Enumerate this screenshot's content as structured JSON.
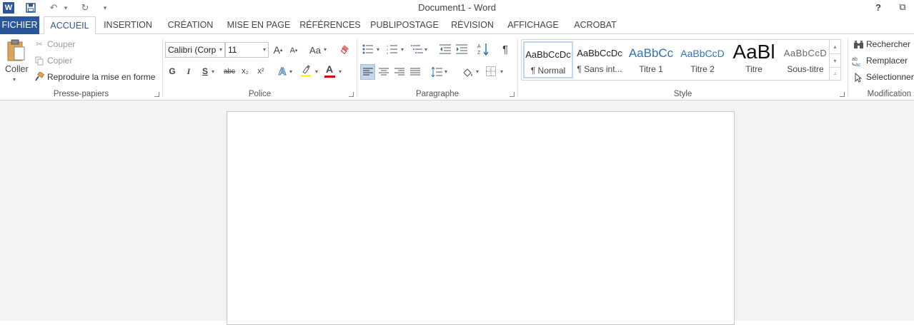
{
  "window": {
    "title": "Document1 - Word",
    "help": "?",
    "restore_glyph": "⧉",
    "minimize_glyph": "—",
    "close_glyph": "✕"
  },
  "qat": {
    "logo": "W",
    "save_glyph": "💾",
    "undo_glyph": "↶",
    "redo_glyph": "↻",
    "dd_glyph": "▾",
    "customize_glyph": "⩡"
  },
  "tabs": {
    "file": "FICHIER",
    "items": [
      "ACCUEIL",
      "INSERTION",
      "CRÉATION",
      "MISE EN PAGE",
      "RÉFÉRENCES",
      "PUBLIPOSTAGE",
      "RÉVISION",
      "AFFICHAGE",
      "ACROBAT"
    ]
  },
  "clipboard": {
    "label": "Presse-papiers",
    "paste": "Coller",
    "cut": "Couper",
    "copy": "Copier",
    "format_painter": "Reproduire la mise en forme"
  },
  "font": {
    "label": "Police",
    "font_name": "Calibri (Corp",
    "font_size": "11",
    "grow": "A",
    "shrink": "A",
    "change_case": "Aa",
    "bold": "G",
    "italic": "I",
    "underline": "S",
    "strike": "abc",
    "subscript": "x₂",
    "superscript": "x²",
    "text_effects": "A",
    "font_color": "A",
    "highlight_color": "#ffff00",
    "font_color_value": "#e00000"
  },
  "paragraph": {
    "label": "Paragraphe",
    "show_marks": "¶"
  },
  "styles": {
    "label": "Style",
    "items": [
      {
        "preview": "AaBbCcDc",
        "label": "¶ Normal"
      },
      {
        "preview": "AaBbCcDc",
        "label": "¶ Sans int..."
      },
      {
        "preview": "AaBbCc",
        "label": "Titre 1"
      },
      {
        "preview": "AaBbCcD",
        "label": "Titre 2"
      },
      {
        "preview": "AaBl",
        "label": "Titre"
      },
      {
        "preview": "AaBbCcD",
        "label": "Sous-titre"
      }
    ]
  },
  "editing": {
    "label": "Modification",
    "find": "Rechercher",
    "replace": "Remplacer",
    "select": "Sélectionner"
  },
  "colors": {
    "accent": "#2b579a",
    "heading": "#2e74b5"
  }
}
